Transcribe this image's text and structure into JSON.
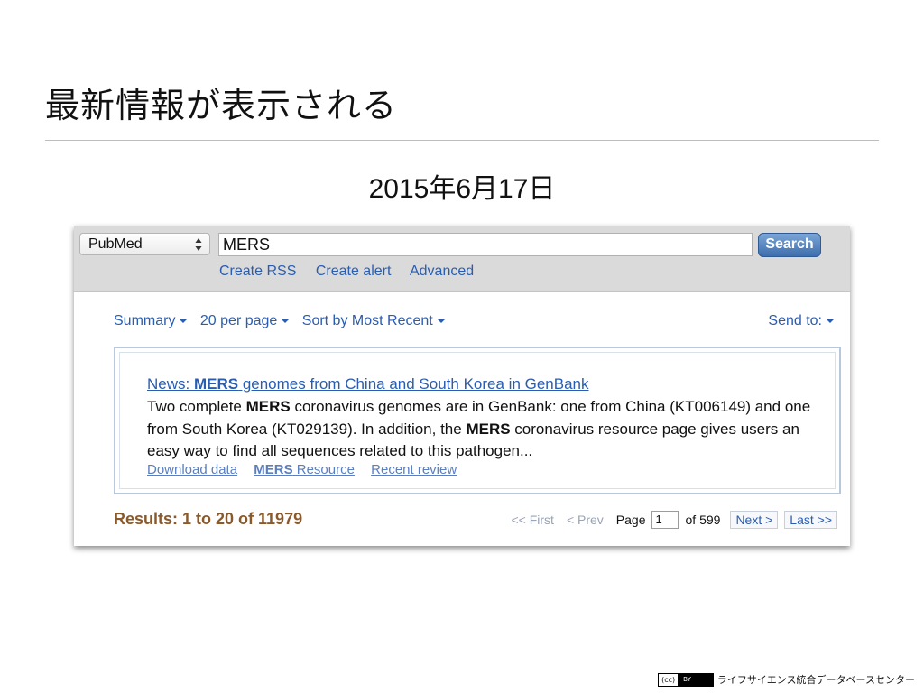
{
  "slide": {
    "title": "最新情報が表示される",
    "date": "2015年6月17日"
  },
  "search_bar": {
    "database": "PubMed",
    "term": "MERS",
    "search_label": "Search",
    "links": [
      "Create RSS",
      "Create alert",
      "Advanced"
    ]
  },
  "display_settings": {
    "format": "Summary",
    "per_page": "20 per page",
    "sort": "Sort by Most Recent",
    "send_to": "Send to:"
  },
  "news": {
    "title_prefix": "News: ",
    "title_term": "MERS",
    "title_rest": " genomes from China and South Korea in GenBank",
    "body_1": "Two complete ",
    "body_term_1": "MERS",
    "body_2": " coronavirus genomes are in GenBank: one from China (KT006149) and one from South Korea (KT029139). In addition, the ",
    "body_term_2": "MERS",
    "body_3": " coronavirus resource page gives users an easy way to find all sequences related to this pathogen...",
    "link_download": "Download data",
    "link_resource_term": "MERS",
    "link_resource_rest": " Resource",
    "link_review": "Recent review"
  },
  "results": {
    "count_text": "Results: 1 to 20 of 11979"
  },
  "pager": {
    "first": "<< First",
    "prev": "< Prev",
    "page_label": "Page",
    "page_value": "1",
    "of_text": "of 599",
    "next": "Next >",
    "last": "Last >>"
  },
  "footer": {
    "cc_label": "(cc)",
    "by_label": "BY",
    "organization": "ライフサイエンス統合データベースセンター"
  },
  "colors": {
    "link": "#2a5db0",
    "results": "#8b5a2b",
    "search_button": "#3e6eae"
  }
}
